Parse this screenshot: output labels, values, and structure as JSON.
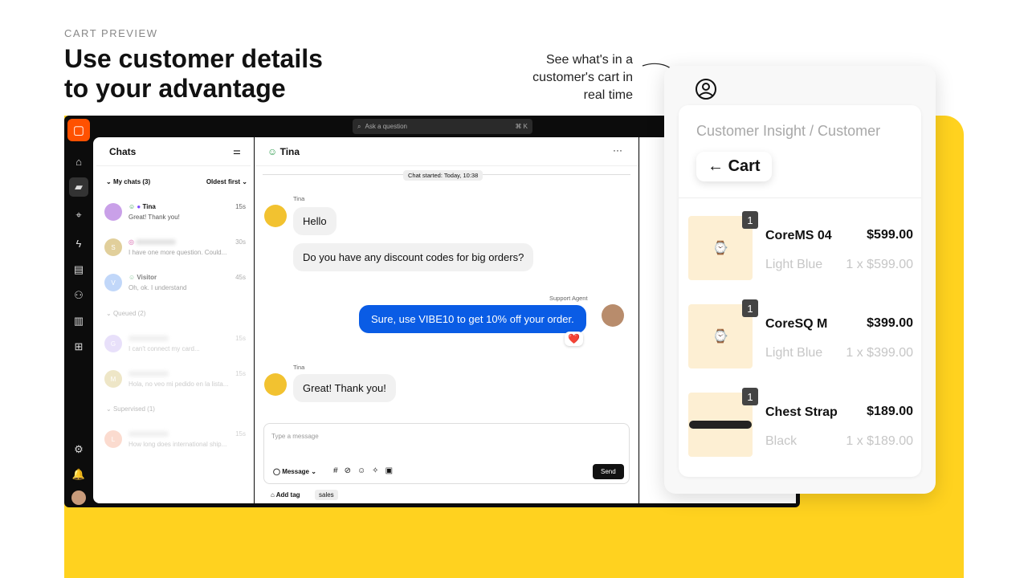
{
  "hero": {
    "eyebrow": "CART PREVIEW",
    "headline": "Use customer details to your advantage",
    "note": "See what's in a customer's cart in real time"
  },
  "app": {
    "search_placeholder": "Ask a question",
    "search_shortcut": "⌘ K",
    "chats": {
      "title": "Chats",
      "my_chats": "My chats (3)",
      "sort": "Oldest first",
      "my": [
        {
          "initial": "",
          "name": "Tina",
          "msg": "Great! Thank you!",
          "time": "15s",
          "color": "#c9a0e8"
        },
        {
          "initial": "S",
          "name": "",
          "msg": "I have one more question. Could...",
          "time": "30s",
          "color": "#c9a94a"
        },
        {
          "initial": "V",
          "name": "Visitor",
          "msg": "Oh, ok. I understand",
          "time": "45s",
          "color": "#8fb7f5"
        }
      ],
      "queued": "Queued (2)",
      "queue": [
        {
          "initial": "G",
          "msg": "I can't connect my card...",
          "time": "15s",
          "color": "#b59af0"
        },
        {
          "initial": "M",
          "msg": "Hola, no veo mi pedido en la lista...",
          "time": "15s",
          "color": "#c9b04a"
        }
      ],
      "supervised": "Supervised (1)",
      "super": [
        {
          "initial": "L",
          "msg": "How long does international ship...",
          "time": "15s",
          "color": "#f58a62"
        }
      ]
    },
    "conversation": {
      "contact": "Tina",
      "started": "Chat started: Today, 10:38",
      "customer_label": "Tina",
      "agent_label": "Support Agent",
      "messages": [
        "Hello",
        "Do you have any discount codes for big orders?",
        "Sure, use VIBE10 to get 10% off your order.",
        "Great! Thank you!"
      ],
      "reaction": "❤️",
      "composer_placeholder": "Type a message",
      "mode": "Message",
      "send": "Send",
      "add_tag": "Add tag",
      "tag": "sales"
    }
  },
  "cart": {
    "breadcrumb": "Customer Insight / Customer",
    "title": "Cart",
    "items": [
      {
        "name": "CoreMS 04",
        "price": "$599.00",
        "variant": "Light Blue",
        "line": "1 x $599.00",
        "qty": "1"
      },
      {
        "name": "CoreSQ M",
        "price": "$399.00",
        "variant": "Light Blue",
        "line": "1 x $399.00",
        "qty": "1"
      },
      {
        "name": "Chest Strap",
        "price": "$189.00",
        "variant": "Black",
        "line": "1 x $189.00",
        "qty": "1"
      }
    ]
  },
  "colors": {
    "accent": "#0a5ce5",
    "brand": "#ff5100",
    "yellow": "#ffd21f"
  }
}
